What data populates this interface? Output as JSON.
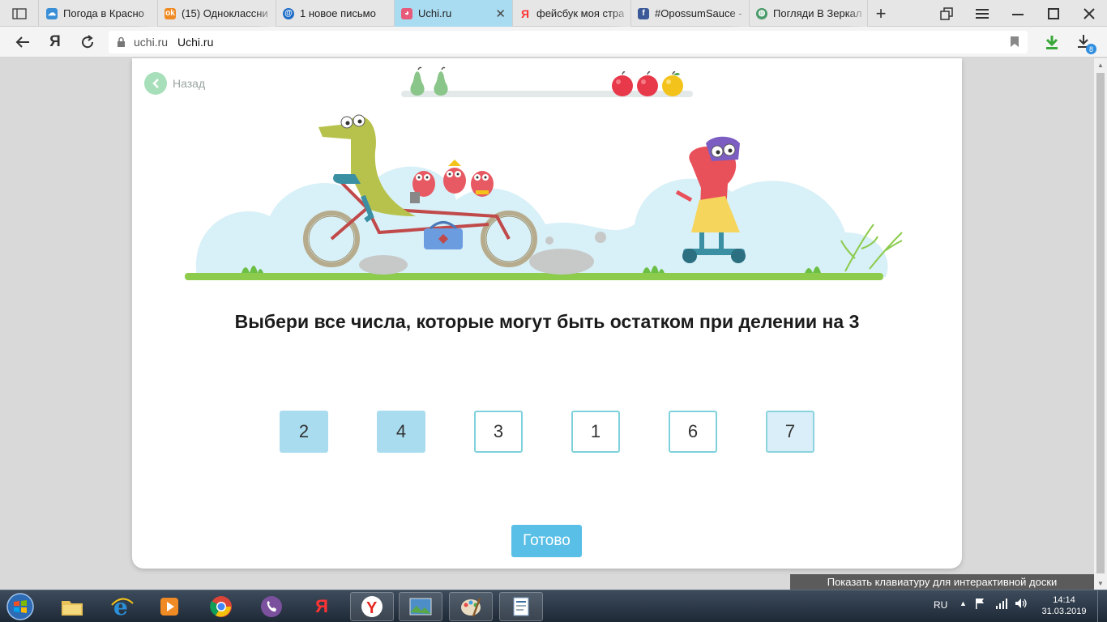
{
  "browser": {
    "tabs": [
      {
        "label": "Погода в Красно",
        "icon": "weather-icon",
        "color": "#3a8fd6"
      },
      {
        "label": "(15) Одноклассни",
        "icon": "odnoklassniki-icon",
        "color": "#f08a24"
      },
      {
        "label": "1 новое письмо",
        "icon": "mail-icon",
        "color": "#1e6ec8"
      },
      {
        "label": "Uchi.ru",
        "icon": "uchi-icon",
        "color": "#e85a7a",
        "active": true
      },
      {
        "label": "фейсбук моя стра",
        "icon": "yandex-icon",
        "color": "#ff3333"
      },
      {
        "label": "#OpossumSauce -",
        "icon": "facebook-icon",
        "color": "#3b5998"
      },
      {
        "label": "Погляди В Зеркал",
        "icon": "globe-icon",
        "color": "#4a9a6a"
      }
    ],
    "address": {
      "domain": "uchi.ru",
      "title": "Uchi.ru"
    },
    "downloads_badge": "8"
  },
  "page": {
    "back_label": "Назад",
    "question": "Выбери все числа, которые могут быть остатком при делении на 3",
    "options": [
      {
        "label": "2",
        "state": "selected"
      },
      {
        "label": "4",
        "state": "selected"
      },
      {
        "label": "3",
        "state": "normal"
      },
      {
        "label": "1",
        "state": "normal"
      },
      {
        "label": "6",
        "state": "normal"
      },
      {
        "label": "7",
        "state": "hover"
      }
    ],
    "done_label": "Готово",
    "progress": {
      "pears": 2,
      "apples": 3
    }
  },
  "keyboard_tip": "Показать клавиатуру для интерактивной доски",
  "taskbar": {
    "language": "RU",
    "time": "14:14",
    "date": "31.03.2019"
  },
  "colors": {
    "accent": "#59bfe7",
    "option_border": "#7fd1db",
    "option_selected": "#a9dcef",
    "active_tab": "#a9dcf1"
  }
}
